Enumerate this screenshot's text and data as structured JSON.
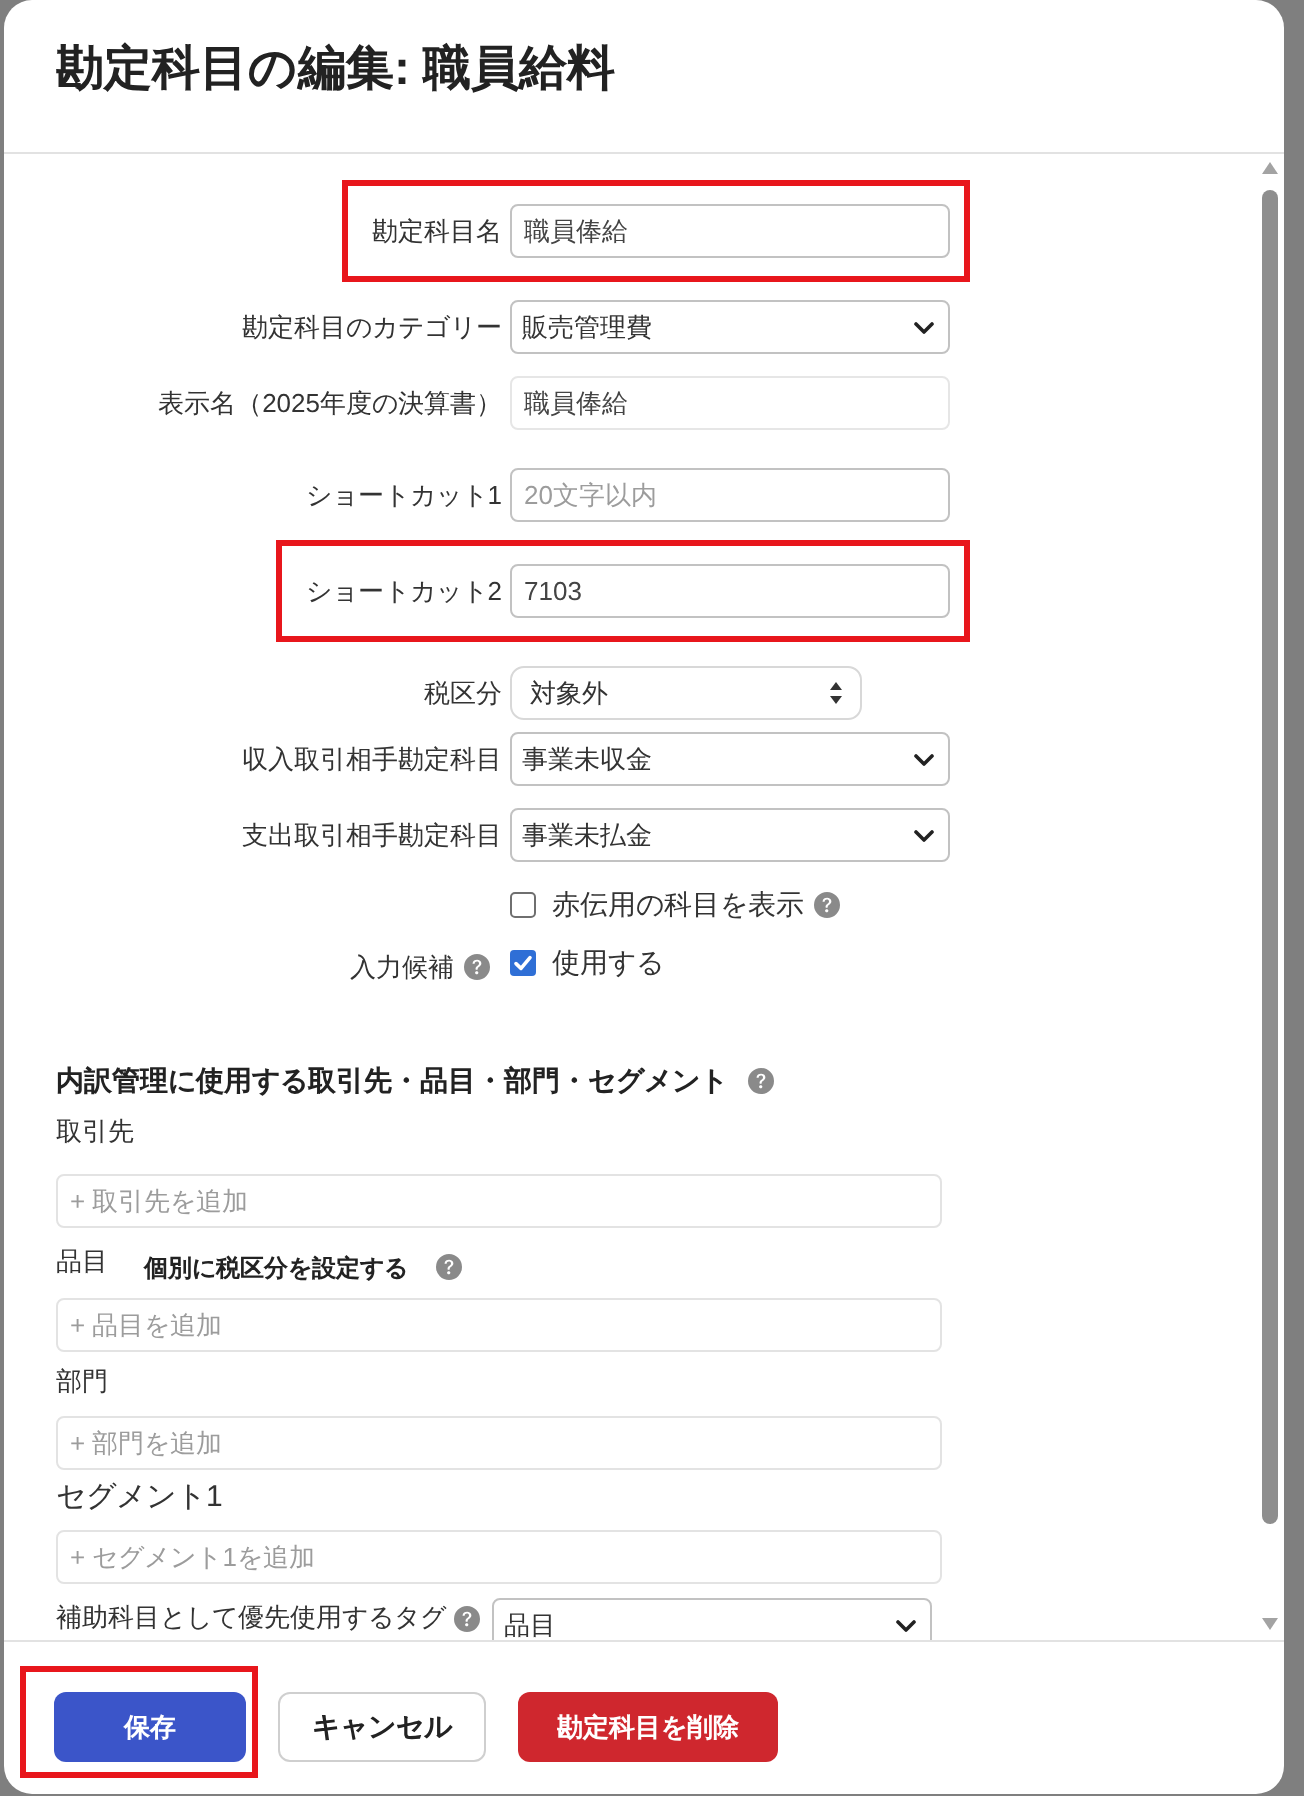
{
  "dialog": {
    "title": "勘定科目の編集: 職員給料"
  },
  "fields": [
    {
      "kind": "input",
      "label": "勘定科目名",
      "value": "職員俸給",
      "readonly": false,
      "highlighted": true
    },
    {
      "kind": "select",
      "label": "勘定科目のカテゴリー",
      "value": "販売管理費",
      "highlighted": false
    },
    {
      "kind": "input",
      "label": "表示名（2025年度の決算書）",
      "value": "職員俸給",
      "readonly": true,
      "highlighted": false
    },
    {
      "kind": "input",
      "label": "ショートカット1",
      "placeholder": "20文字以内",
      "readonly": false,
      "highlighted": false
    },
    {
      "kind": "input",
      "label": "ショートカット2",
      "value": "7103",
      "readonly": false,
      "highlighted": true
    },
    {
      "kind": "picker",
      "label": "税区分",
      "value": "対象外",
      "highlighted": false
    },
    {
      "kind": "select",
      "label": "収入取引相手勘定科目",
      "value": "事業未収金",
      "highlighted": false
    },
    {
      "kind": "select",
      "label": "支出取引相手勘定科目",
      "value": "事業未払金",
      "highlighted": false
    }
  ],
  "options": [
    {
      "text": "赤伝用の科目を表示",
      "checked": false,
      "help_icon": true
    },
    {
      "label": "入力候補",
      "label_help_icon": true,
      "text": "使用する",
      "checked": true,
      "help_icon": false
    }
  ],
  "breakdown": {
    "heading": "内訳管理に使用する取引先・品目・部門・セグメント",
    "help_icon": true,
    "groups": [
      {
        "label": "取引先",
        "placeholder": "+ 取引先を追加"
      },
      {
        "label": "品目",
        "note": "個別に税区分を設定する",
        "note_help_icon": true,
        "placeholder": "+ 品目を追加"
      },
      {
        "label": "部門",
        "placeholder": "+ 部門を追加"
      },
      {
        "label": "セグメント1",
        "placeholder": "+ セグメント1を追加"
      }
    ],
    "tag_field": {
      "label": "補助科目として優先使用するタグ",
      "help_icon": true,
      "value": "品目"
    }
  },
  "buttons": [
    {
      "kind": "primary",
      "label": "保存",
      "highlighted": true
    },
    {
      "kind": "secondary",
      "label": "キャンセル",
      "highlighted": false
    },
    {
      "kind": "danger",
      "label": "勘定科目を削除",
      "highlighted": false
    }
  ]
}
